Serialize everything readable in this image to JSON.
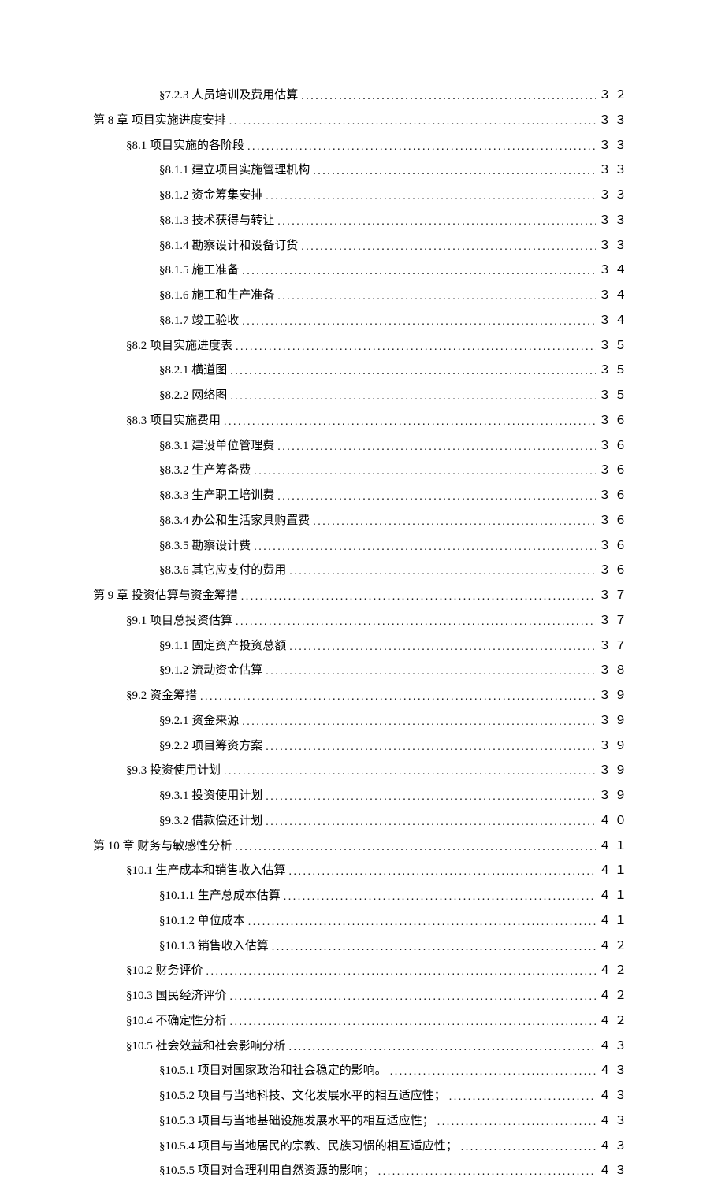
{
  "toc": [
    {
      "indent": 2,
      "title": "§7.2.3  人员培训及费用估算",
      "page": "３２"
    },
    {
      "indent": 0,
      "title": "第 8 章  项目实施进度安排",
      "page": "３３"
    },
    {
      "indent": 1,
      "title": "§8.1  项目实施的各阶段",
      "page": "３３"
    },
    {
      "indent": 2,
      "title": "§8.1.1  建立项目实施管理机构",
      "page": "３３"
    },
    {
      "indent": 2,
      "title": "§8.1.2  资金筹集安排",
      "page": "３３"
    },
    {
      "indent": 2,
      "title": "§8.1.3  技术获得与转让",
      "page": "３３"
    },
    {
      "indent": 2,
      "title": "§8.1.4  勘察设计和设备订货",
      "page": "３３"
    },
    {
      "indent": 2,
      "title": "§8.1.5  施工准备",
      "page": "３４"
    },
    {
      "indent": 2,
      "title": "§8.1.6  施工和生产准备",
      "page": "３４"
    },
    {
      "indent": 2,
      "title": "§8.1.7  竣工验收",
      "page": "３４"
    },
    {
      "indent": 1,
      "title": "§8.2  项目实施进度表",
      "page": "３５"
    },
    {
      "indent": 2,
      "title": "§8.2.1  横道图",
      "page": "３５"
    },
    {
      "indent": 2,
      "title": "§8.2.2  网络图",
      "page": "３５"
    },
    {
      "indent": 1,
      "title": "§8.3  项目实施费用",
      "page": "３６"
    },
    {
      "indent": 2,
      "title": "§8.3.1  建设单位管理费",
      "page": "３６"
    },
    {
      "indent": 2,
      "title": "§8.3.2  生产筹备费",
      "page": "３６"
    },
    {
      "indent": 2,
      "title": "§8.3.3  生产职工培训费",
      "page": "３６"
    },
    {
      "indent": 2,
      "title": "§8.3.4  办公和生活家具购置费",
      "page": "３６"
    },
    {
      "indent": 2,
      "title": "§8.3.5  勘察设计费",
      "page": "３６"
    },
    {
      "indent": 2,
      "title": "§8.3.6  其它应支付的费用",
      "page": "３６"
    },
    {
      "indent": 0,
      "title": "第 9 章  投资估算与资金筹措",
      "page": "３７"
    },
    {
      "indent": 1,
      "title": "§9.1  项目总投资估算",
      "page": "３７"
    },
    {
      "indent": 2,
      "title": "§9.1.1  固定资产投资总额",
      "page": "３７"
    },
    {
      "indent": 2,
      "title": "§9.1.2  流动资金估算",
      "page": "３８"
    },
    {
      "indent": 1,
      "title": "§9.2  资金筹措",
      "page": "３９"
    },
    {
      "indent": 2,
      "title": "§9.2.1  资金来源",
      "page": "３９"
    },
    {
      "indent": 2,
      "title": "§9.2.2  项目筹资方案",
      "page": "３９"
    },
    {
      "indent": 1,
      "title": "§9.3  投资使用计划",
      "page": "３９"
    },
    {
      "indent": 2,
      "title": "§9.3.1  投资使用计划",
      "page": "３９"
    },
    {
      "indent": 2,
      "title": "§9.3.2  借款偿还计划",
      "page": "４０"
    },
    {
      "indent": 0,
      "title": "第 10 章  财务与敏感性分析",
      "page": "４１"
    },
    {
      "indent": 1,
      "title": "§10.1  生产成本和销售收入估算",
      "page": "４１"
    },
    {
      "indent": 2,
      "title": "§10.1.1  生产总成本估算",
      "page": "４１"
    },
    {
      "indent": 2,
      "title": "§10.1.2  单位成本",
      "page": "４１"
    },
    {
      "indent": 2,
      "title": "§10.1.3  销售收入估算",
      "page": "４２"
    },
    {
      "indent": 1,
      "title": "§10.2  财务评价",
      "page": "４２"
    },
    {
      "indent": 1,
      "title": "§10.3  国民经济评价",
      "page": "４２"
    },
    {
      "indent": 1,
      "title": "§10.4  不确定性分析",
      "page": "４２"
    },
    {
      "indent": 1,
      "title": "§10.5  社会效益和社会影响分析",
      "page": "４３"
    },
    {
      "indent": 2,
      "title": "§10.5.1  项目对国家政治和社会稳定的影响。",
      "page": "４３"
    },
    {
      "indent": 2,
      "title": "§10.5.2  项目与当地科技、文化发展水平的相互适应性；",
      "page": "４３"
    },
    {
      "indent": 2,
      "title": "§10.5.3  项目与当地基础设施发展水平的相互适应性；",
      "page": "４３"
    },
    {
      "indent": 2,
      "title": "§10.5.4  项目与当地居民的宗教、民族习惯的相互适应性；",
      "page": "４３"
    },
    {
      "indent": 2,
      "title": "§10.5.5  项目对合理利用自然资源的影响；",
      "page": "４３"
    }
  ]
}
